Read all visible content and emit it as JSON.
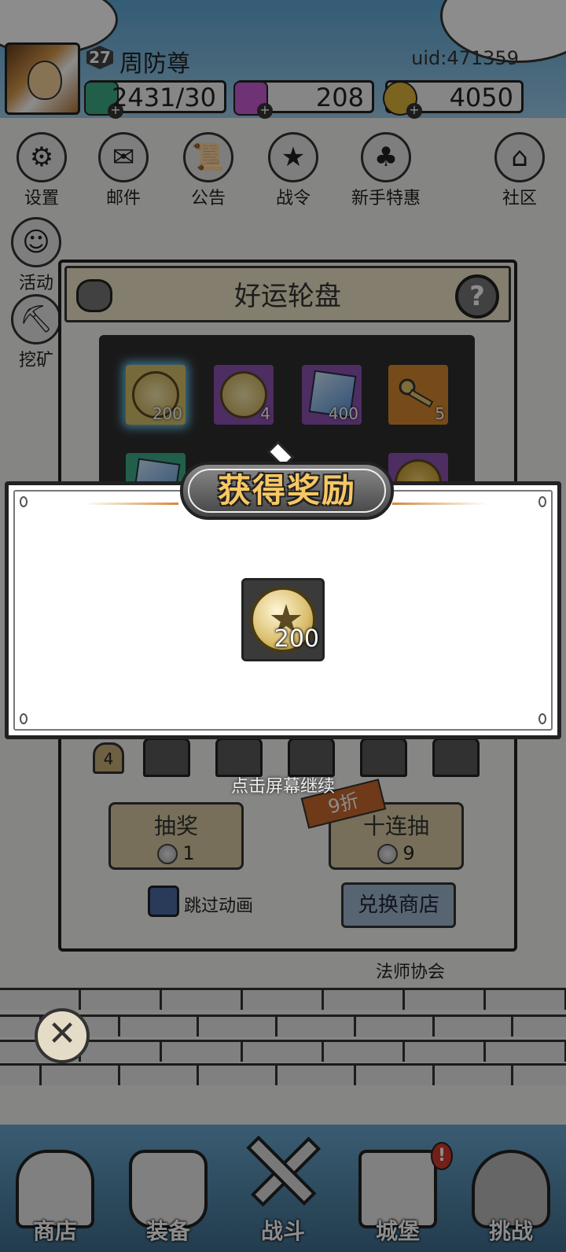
{
  "player": {
    "level": "27",
    "name": "周防尊",
    "uid": "uid:471359"
  },
  "resources": [
    {
      "icon": "stamina-crystal-icon",
      "value": "2431/30",
      "color": "#3fae88"
    },
    {
      "icon": "diamond-icon",
      "value": "208",
      "color": "#c85bd6"
    },
    {
      "icon": "gold-coin-icon",
      "value": "4050",
      "color": "#e1b53b"
    }
  ],
  "menu_row1": [
    {
      "icon": "gear-icon",
      "label": "设置"
    },
    {
      "icon": "mail-icon",
      "label": "邮件"
    },
    {
      "icon": "scroll-icon",
      "label": "公告"
    },
    {
      "icon": "battle-pass-icon",
      "label": "战令"
    },
    {
      "icon": "gift-bag-icon",
      "label": "新手特惠"
    },
    {
      "icon": "home-icon",
      "label": "社区"
    }
  ],
  "menu_row2": [
    {
      "icon": "activity-icon",
      "label": "活动"
    },
    {
      "icon": "mining-icon",
      "label": "挖矿"
    }
  ],
  "wheel": {
    "title": "好运轮盘",
    "help": "?",
    "slots": [
      {
        "type": "coin",
        "count": "200",
        "bg": "#d7c16a"
      },
      {
        "type": "coin",
        "count": "4",
        "bg": "#8e53b3"
      },
      {
        "type": "gem",
        "count": "400",
        "bg": "#8e53b3"
      },
      {
        "type": "key",
        "count": "5",
        "bg": "#d9892f"
      }
    ],
    "progress_bell": "4",
    "draw_one": {
      "label": "抽奖",
      "cost": "1"
    },
    "draw_ten": {
      "label": "十连抽",
      "cost": "9"
    },
    "discount": "9折",
    "skip_animation": "跳过动画",
    "exchange_shop": "兑换商店",
    "guild_label": "法师协会"
  },
  "reward": {
    "title": "获得奖励",
    "item_icon": "star-coin-icon",
    "item_count": "200",
    "continue_hint": "点击屏幕继续"
  },
  "bottom_nav": [
    {
      "icon": "shop-icon",
      "label": "商店"
    },
    {
      "icon": "equipment-icon",
      "label": "装备"
    },
    {
      "icon": "crossed-swords-icon",
      "label": "战斗"
    },
    {
      "icon": "castle-icon",
      "label": "城堡"
    },
    {
      "icon": "challenge-icon",
      "label": "挑战"
    }
  ],
  "close_symbol": "✕"
}
